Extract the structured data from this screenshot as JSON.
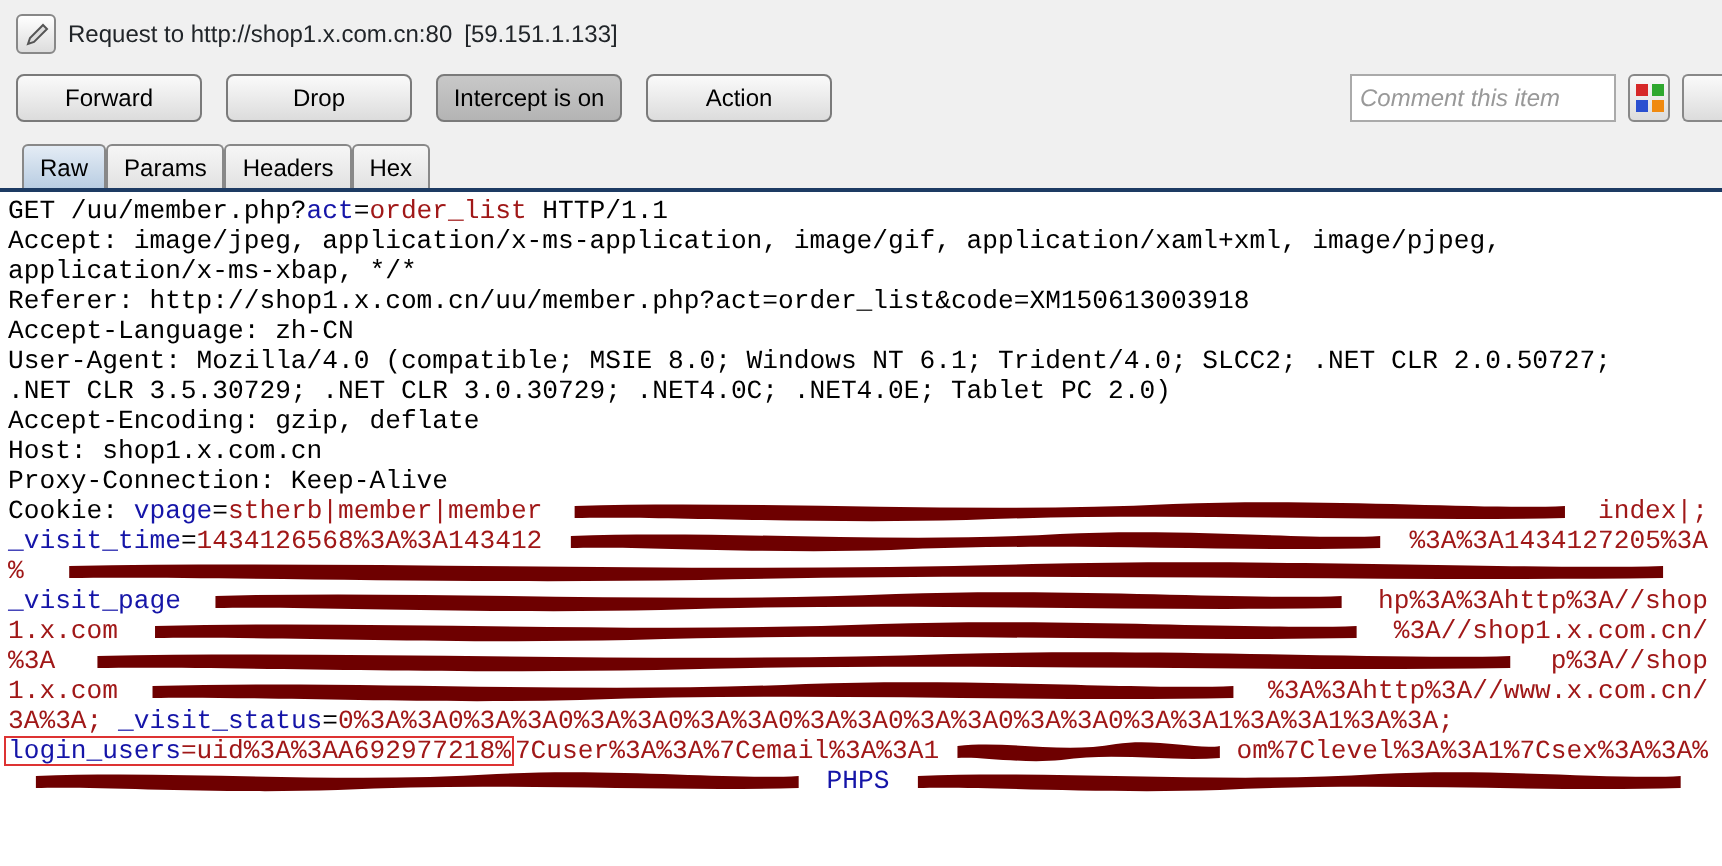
{
  "title": {
    "request": "Request to http://shop1.x.com.cn:80",
    "ip": "[59.151.1.133]"
  },
  "buttons": [
    {
      "label": "Forward",
      "selected": false
    },
    {
      "label": "Drop",
      "selected": false
    },
    {
      "label": "Intercept is on",
      "selected": true
    },
    {
      "label": "Action",
      "selected": false
    }
  ],
  "comment": {
    "placeholder": "Comment this item"
  },
  "tabs": [
    {
      "label": "Raw",
      "selected": true
    },
    {
      "label": "Params",
      "selected": false
    },
    {
      "label": "Headers",
      "selected": false
    },
    {
      "label": "Hex",
      "selected": false
    }
  ],
  "lines": [
    {
      "segments": [
        {
          "kind": "plain",
          "text": "GET /uu/member.php?"
        },
        {
          "kind": "name",
          "text": "act"
        },
        {
          "kind": "plain",
          "text": "="
        },
        {
          "kind": "value",
          "text": "order_list"
        },
        {
          "kind": "plain",
          "text": " HTTP/1.1"
        }
      ]
    },
    {
      "segments": [
        {
          "kind": "plain",
          "text": "Accept: image/jpeg, application/x-ms-application, image/gif, application/xaml+xml, image/pjpeg,"
        }
      ]
    },
    {
      "segments": [
        {
          "kind": "plain",
          "text": "application/x-ms-xbap, */*"
        }
      ]
    },
    {
      "segments": [
        {
          "kind": "plain",
          "text": "Referer: http://shop1.x.com.cn/uu/member.php?act=order_list&code=XM150613003918"
        }
      ]
    },
    {
      "segments": [
        {
          "kind": "plain",
          "text": "Accept-Language: zh-CN"
        }
      ]
    },
    {
      "segments": [
        {
          "kind": "plain",
          "text": "User-Agent: Mozilla/4.0 (compatible; MSIE 8.0; Windows NT 6.1; Trident/4.0; SLCC2; .NET CLR 2.0.50727;"
        }
      ]
    },
    {
      "segments": [
        {
          "kind": "plain",
          "text": ".NET CLR 3.5.30729; .NET CLR 3.0.30729; .NET4.0C; .NET4.0E; Tablet PC 2.0)"
        }
      ]
    },
    {
      "segments": [
        {
          "kind": "plain",
          "text": "Accept-Encoding: gzip, deflate"
        }
      ]
    },
    {
      "segments": [
        {
          "kind": "plain",
          "text": "Host: shop1.x.com.cn"
        }
      ]
    },
    {
      "segments": [
        {
          "kind": "plain",
          "text": "Proxy-Connection: Keep-Alive"
        }
      ]
    },
    {
      "segments": [
        {
          "kind": "plain",
          "text": "Cookie: "
        },
        {
          "kind": "name",
          "text": "vpage"
        },
        {
          "kind": "plain",
          "text": "="
        },
        {
          "kind": "value",
          "text": "stherb|member|member"
        },
        {
          "kind": "gap"
        },
        {
          "kind": "value",
          "text": "index|;"
        }
      ]
    },
    {
      "segments": [
        {
          "kind": "name",
          "text": "_visit_time"
        },
        {
          "kind": "plain",
          "text": "="
        },
        {
          "kind": "value",
          "text": "1434126568%3A%3A143412"
        },
        {
          "kind": "gap"
        },
        {
          "kind": "value",
          "text": "%3A%3A1434127205%3A"
        }
      ]
    },
    {
      "segments": [
        {
          "kind": "value",
          "text": "%"
        },
        {
          "kind": "gap"
        }
      ]
    },
    {
      "segments": [
        {
          "kind": "name",
          "text": "_visit_page"
        },
        {
          "kind": "gap"
        },
        {
          "kind": "value",
          "text": "hp%3A%3Ahttp%3A//shop"
        }
      ]
    },
    {
      "segments": [
        {
          "kind": "value",
          "text": "1.x.com"
        },
        {
          "kind": "gap"
        },
        {
          "kind": "value",
          "text": "%3A//shop1.x.com.cn/"
        }
      ]
    },
    {
      "segments": [
        {
          "kind": "value",
          "text": "%3A"
        },
        {
          "kind": "gap"
        },
        {
          "kind": "value",
          "text": "p%3A//shop"
        }
      ]
    },
    {
      "segments": [
        {
          "kind": "value",
          "text": "1.x.com"
        },
        {
          "kind": "gap"
        },
        {
          "kind": "value",
          "text": "%3A%3Ahttp%3A//www.x.com.cn/"
        }
      ]
    },
    {
      "segments": [
        {
          "kind": "value",
          "text": "3A%3A; "
        },
        {
          "kind": "name",
          "text": "_visit_status"
        },
        {
          "kind": "plain",
          "text": "="
        },
        {
          "kind": "value",
          "text": "0%3A%3A0%3A%3A0%3A%3A0%3A%3A0%3A%3A0%3A%3A0%3A%3A0%3A%3A1%3A%3A1%3A%3A;"
        }
      ]
    },
    {
      "segments": [
        {
          "kind": "boxed",
          "name": "login_users",
          "text": "=uid%3A%3AA692977218%"
        },
        {
          "kind": "value",
          "text": "7Cuser%3A%3A%7Cemail%3A%3A1"
        },
        {
          "kind": "gap"
        },
        {
          "kind": "value",
          "text": "om%7Clevel%3A%3A1%7Csex%3A%3A%"
        }
      ]
    },
    {
      "segments": [
        {
          "kind": "gap"
        },
        {
          "kind": "name",
          "text": "PHPS"
        },
        {
          "kind": "gap"
        }
      ]
    }
  ]
}
